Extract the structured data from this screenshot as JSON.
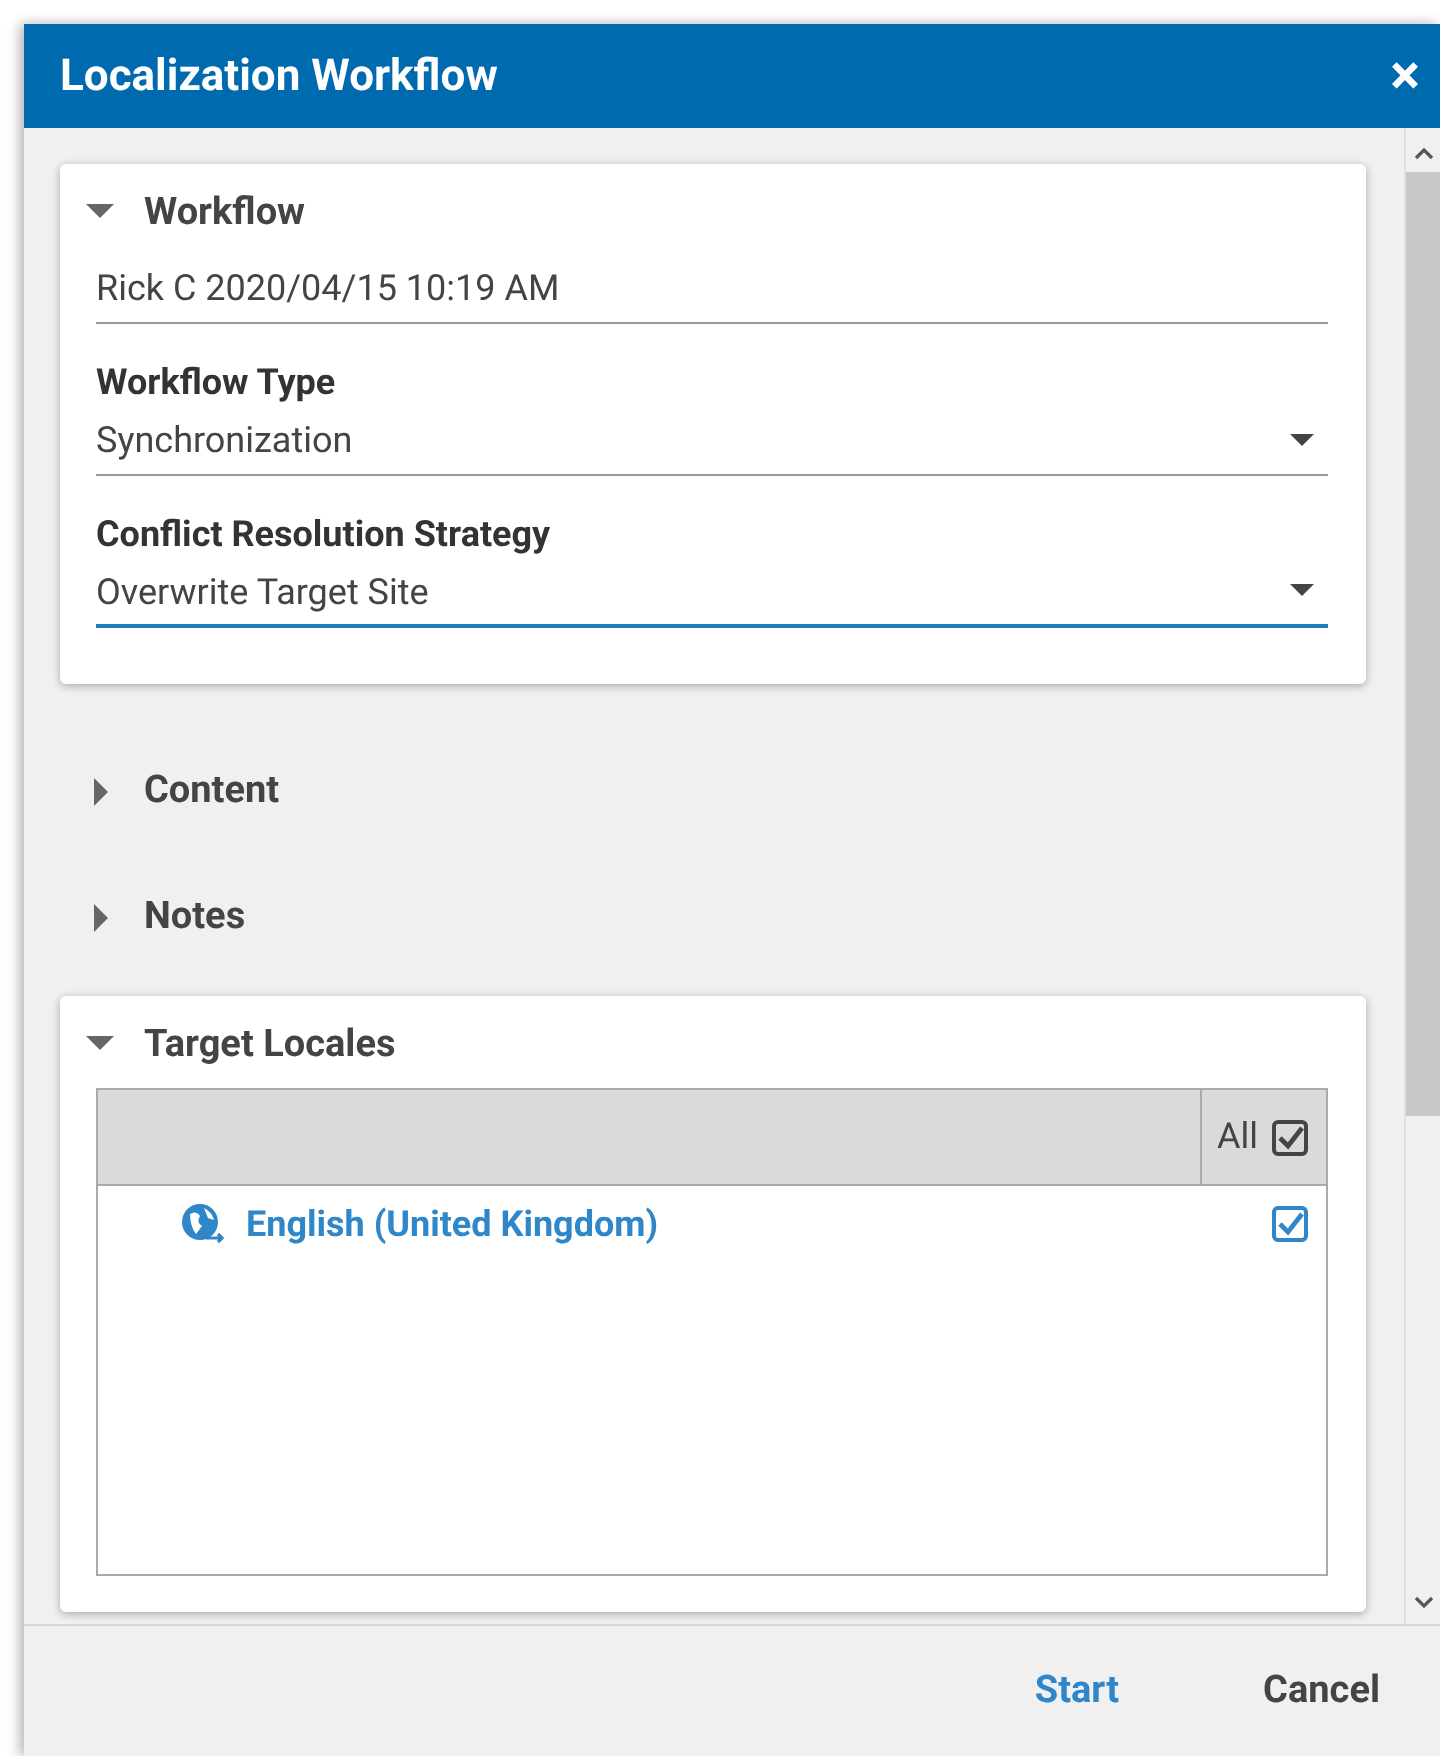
{
  "window": {
    "title": "Localization Workflow",
    "close": "×"
  },
  "sections": [
    {
      "kind": "form",
      "title": "Workflow",
      "expanded": true,
      "fields": [
        {
          "kind": "text",
          "value": "Rick C 2020/04/15 10:19 AM",
          "focused": false
        },
        {
          "kind": "select",
          "label": "Workflow Type",
          "value": "Synchronization",
          "focused": false
        },
        {
          "kind": "select",
          "label": "Conflict Resolution Strategy",
          "value": "Overwrite Target Site",
          "focused": true
        }
      ]
    },
    {
      "kind": "plain",
      "title": "Content",
      "expanded": false
    },
    {
      "kind": "plain",
      "title": "Notes",
      "expanded": false
    },
    {
      "kind": "locales",
      "title": "Target Locales",
      "expanded": true,
      "all_label": "All",
      "all_checked": true,
      "locales": [
        {
          "name": "English (United Kingdom)",
          "checked": true
        }
      ]
    }
  ],
  "buttons": [
    {
      "label": "Start",
      "kind": "primary"
    },
    {
      "label": "Cancel",
      "kind": "secondary"
    }
  ]
}
